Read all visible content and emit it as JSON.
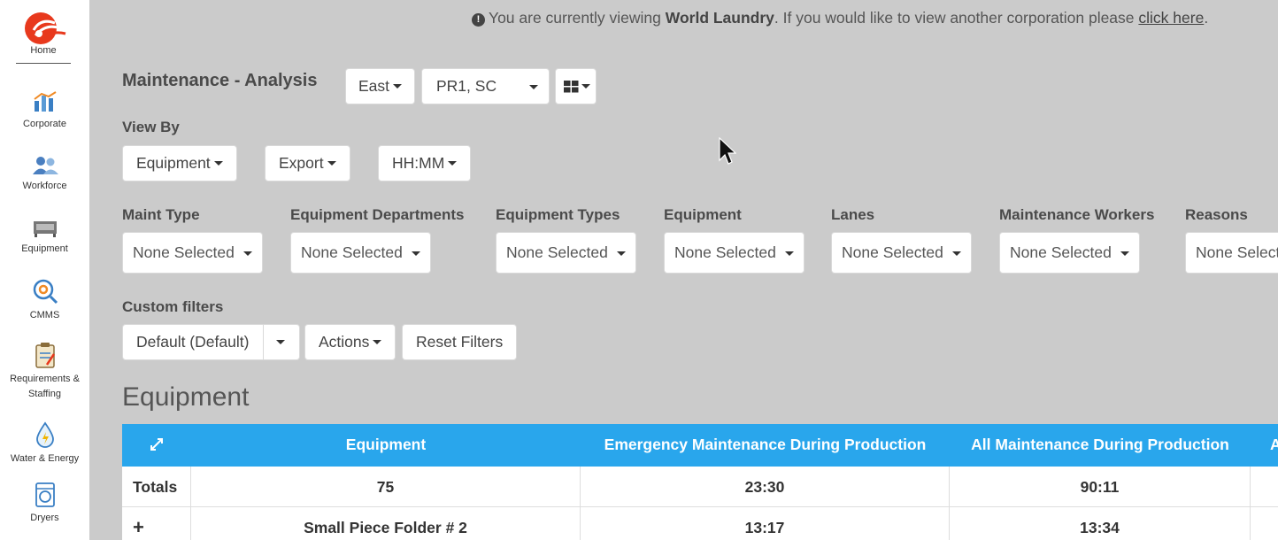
{
  "sidebar": {
    "home_label": "Home",
    "items": [
      {
        "label": "Corporate",
        "icon": "bar-chart-icon"
      },
      {
        "label": "Workforce",
        "icon": "users-icon"
      },
      {
        "label": "Equipment",
        "icon": "machine-icon"
      },
      {
        "label": "CMMS",
        "icon": "gear-search-icon"
      },
      {
        "label": "Requirements &",
        "label2": "Staffing",
        "icon": "clipboard-icon"
      },
      {
        "label": "Water & Energy",
        "icon": "water-drop-icon"
      },
      {
        "label": "Dryers",
        "icon": "dryer-icon"
      }
    ]
  },
  "notice": {
    "prefix": "You are currently viewing ",
    "corporation": "World Laundry",
    "middle": ". If you would like to view another corporation please ",
    "link": "click here",
    "suffix": "."
  },
  "page_title": "Maintenance - Analysis",
  "region_select": "East",
  "plants_select": "PR1, SC",
  "view_by": {
    "label": "View By",
    "buttons": [
      "Equipment",
      "Export",
      "HH:MM"
    ]
  },
  "filters": [
    {
      "label": "Maint Type",
      "value": "None Selected"
    },
    {
      "label": "Equipment Departments",
      "value": "None Selected"
    },
    {
      "label": "Equipment Types",
      "value": "None Selected"
    },
    {
      "label": "Equipment",
      "value": "None Selected"
    },
    {
      "label": "Lanes",
      "value": "None Selected"
    },
    {
      "label": "Maintenance Workers",
      "value": "None Selected"
    },
    {
      "label": "Reasons",
      "value": "None Select"
    }
  ],
  "custom_filters": {
    "label": "Custom filters",
    "default_value": "Default (Default)",
    "actions": "Actions",
    "reset": "Reset Filters"
  },
  "section_title": "Equipment",
  "table": {
    "columns": [
      "Equipment",
      "Emergency Maintenance During Production",
      "All Maintenance During Production",
      "A"
    ],
    "totals": {
      "label": "Totals",
      "cells": [
        "75",
        "23:30",
        "90:11",
        ""
      ]
    },
    "rows": [
      {
        "expander": "+",
        "cells": [
          "Small Piece Folder # 2",
          "13:17",
          "13:34",
          ""
        ]
      }
    ]
  },
  "colors": {
    "header": "#29a6ec",
    "background": "#cbcbcb",
    "brand": "#e8391d"
  }
}
